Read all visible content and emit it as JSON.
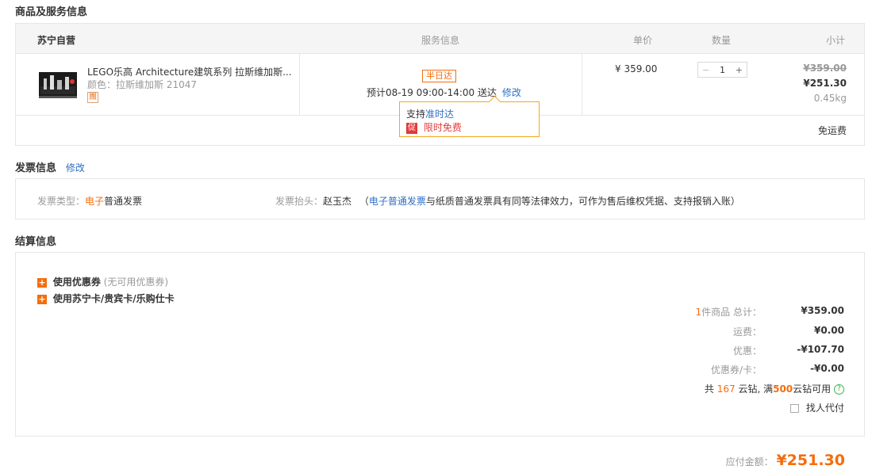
{
  "sections": {
    "product_title": "商品及服务信息",
    "invoice_title": "发票信息",
    "invoice_edit": "修改",
    "settlement_title": "结算信息"
  },
  "table_header": {
    "seller": "苏宁自营",
    "service": "服务信息",
    "unit_price": "单价",
    "quantity": "数量",
    "subtotal": "小计"
  },
  "product": {
    "name": "LEGO乐高 Architecture建筑系列 拉斯维加斯...",
    "color": "颜色：拉斯维加斯 21047",
    "group_tag": "團",
    "delivery_tag": "半日达",
    "delivery_eta": "预计08-19 09:00-14:00 送达",
    "delivery_edit": "修改",
    "unit_price": "¥ 359.00",
    "qty": "1",
    "qty_minus": "−",
    "qty_plus": "+",
    "orig_price": "¥359.00",
    "price": "¥251.30",
    "weight": "0.45kg",
    "shipping": "免运费"
  },
  "popup": {
    "support_prefix": "支持",
    "support_link": "准时达",
    "promo_icon": "促",
    "promo_text": "限时免费"
  },
  "invoice": {
    "type_label": "发票类型：",
    "type_highlight": "电子",
    "type_value": "普通发票",
    "head_label": "发票抬头：",
    "head_value": "赵玉杰",
    "note_open": "（",
    "note_link": "电子普通发票",
    "note_rest": "与纸质普通发票具有同等法律效力，可作为售后维权凭据、支持报销入账）"
  },
  "settlement": {
    "coupon_label": "使用优惠券",
    "coupon_note": "(无可用优惠券)",
    "card_label": "使用苏宁卡/贵宾卡/乐购仕卡",
    "count_prefix": "1",
    "total_label": "件商品  总计：",
    "total_value": "¥359.00",
    "freight_label": "运费：",
    "freight_value": "¥0.00",
    "discount_label": "优惠：",
    "discount_value": "-¥107.70",
    "couponcard_label": "优惠券/卡：",
    "couponcard_value": "-¥0.00",
    "yunzuan_a": "共 ",
    "yunzuan_count": "167",
    "yunzuan_b": " 云钻, 满",
    "yunzuan_threshold": "500",
    "yunzuan_c": "云钻可用",
    "help_icon": "?",
    "proxy_pay": "找人代付",
    "payable_label": "应付金额：",
    "payable_value": "¥251.30"
  },
  "colors": {
    "accent": "#f56d0c",
    "link": "#2e6fc3",
    "promo_red": "#e23a3a",
    "help_green": "#3fb34f"
  }
}
